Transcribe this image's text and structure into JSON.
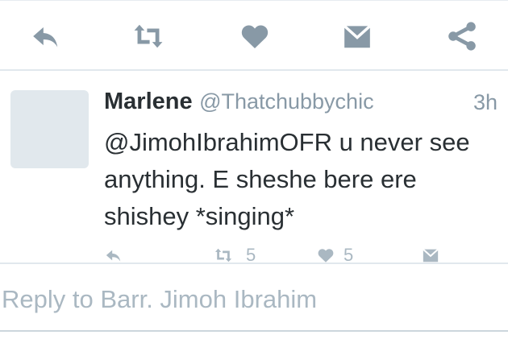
{
  "action_bar": {
    "icons": [
      "reply-icon",
      "retweet-icon",
      "like-icon",
      "direct-message-icon",
      "share-icon"
    ],
    "icon_color": "#8899a6"
  },
  "tweet": {
    "author_name": "Marlene",
    "handle": "@Thatchubbychic",
    "time": "3h",
    "text": "@JimohIbrahimOFR u never see anything. E sheshe bere ere shishey *singing*",
    "retweet_count": "5",
    "like_count": "5",
    "muted_icon_color": "#aab8c2"
  },
  "reply": {
    "placeholder": "Reply to Barr. Jimoh Ibrahim"
  }
}
